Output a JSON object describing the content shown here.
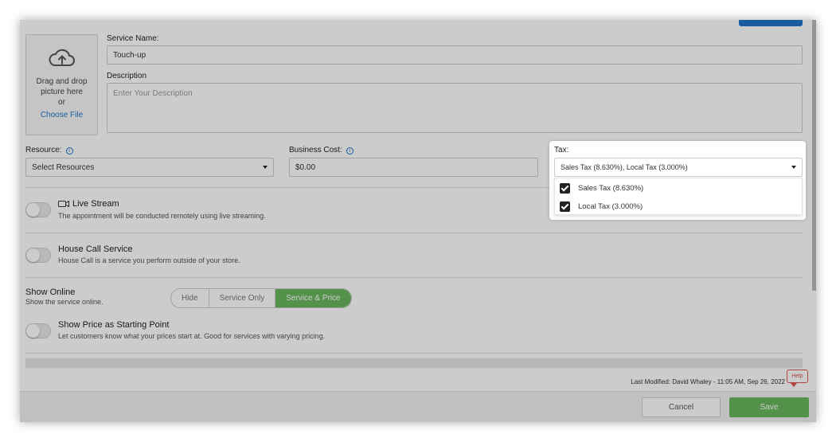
{
  "upload": {
    "line1": "Drag and drop",
    "line2": "picture here",
    "line3": "or",
    "choose_file": "Choose File"
  },
  "service_name": {
    "label": "Service Name:",
    "value": "Touch-up"
  },
  "description": {
    "label": "Description",
    "placeholder": "Enter Your Description"
  },
  "resource": {
    "label": "Resource:",
    "value": "Select Resources"
  },
  "business_cost": {
    "label": "Business Cost:",
    "value": "$0.00"
  },
  "tax": {
    "label": "Tax:",
    "value": "Sales Tax (8.630%), Local Tax (3.000%)",
    "options": [
      {
        "label": "Sales Tax (8.630%)",
        "checked": true
      },
      {
        "label": "Local Tax (3.000%)",
        "checked": true
      }
    ]
  },
  "live_stream": {
    "title": "Live Stream",
    "desc": "The appointment will be conducted remotely using live streaming."
  },
  "house_call": {
    "title": "House Call Service",
    "desc": "House Call is a service you perform outside of your store."
  },
  "show_online": {
    "title": "Show Online",
    "desc": "Show the service online.",
    "options": [
      "Hide",
      "Service Only",
      "Service & Price"
    ],
    "selected": "Service & Price"
  },
  "starting_point": {
    "title": "Show Price as Starting Point",
    "desc": "Let customers know what your prices start at. Good for services with varying pricing."
  },
  "footer": {
    "last_modified": "Last Modified: David Whaley - 11:05 AM, Sep 26, 2022",
    "cancel": "Cancel",
    "save": "Save",
    "help": "Help"
  },
  "colors": {
    "accent": "#1f74c8",
    "primary_green": "#6ab75f",
    "help_red": "#d9534f"
  }
}
